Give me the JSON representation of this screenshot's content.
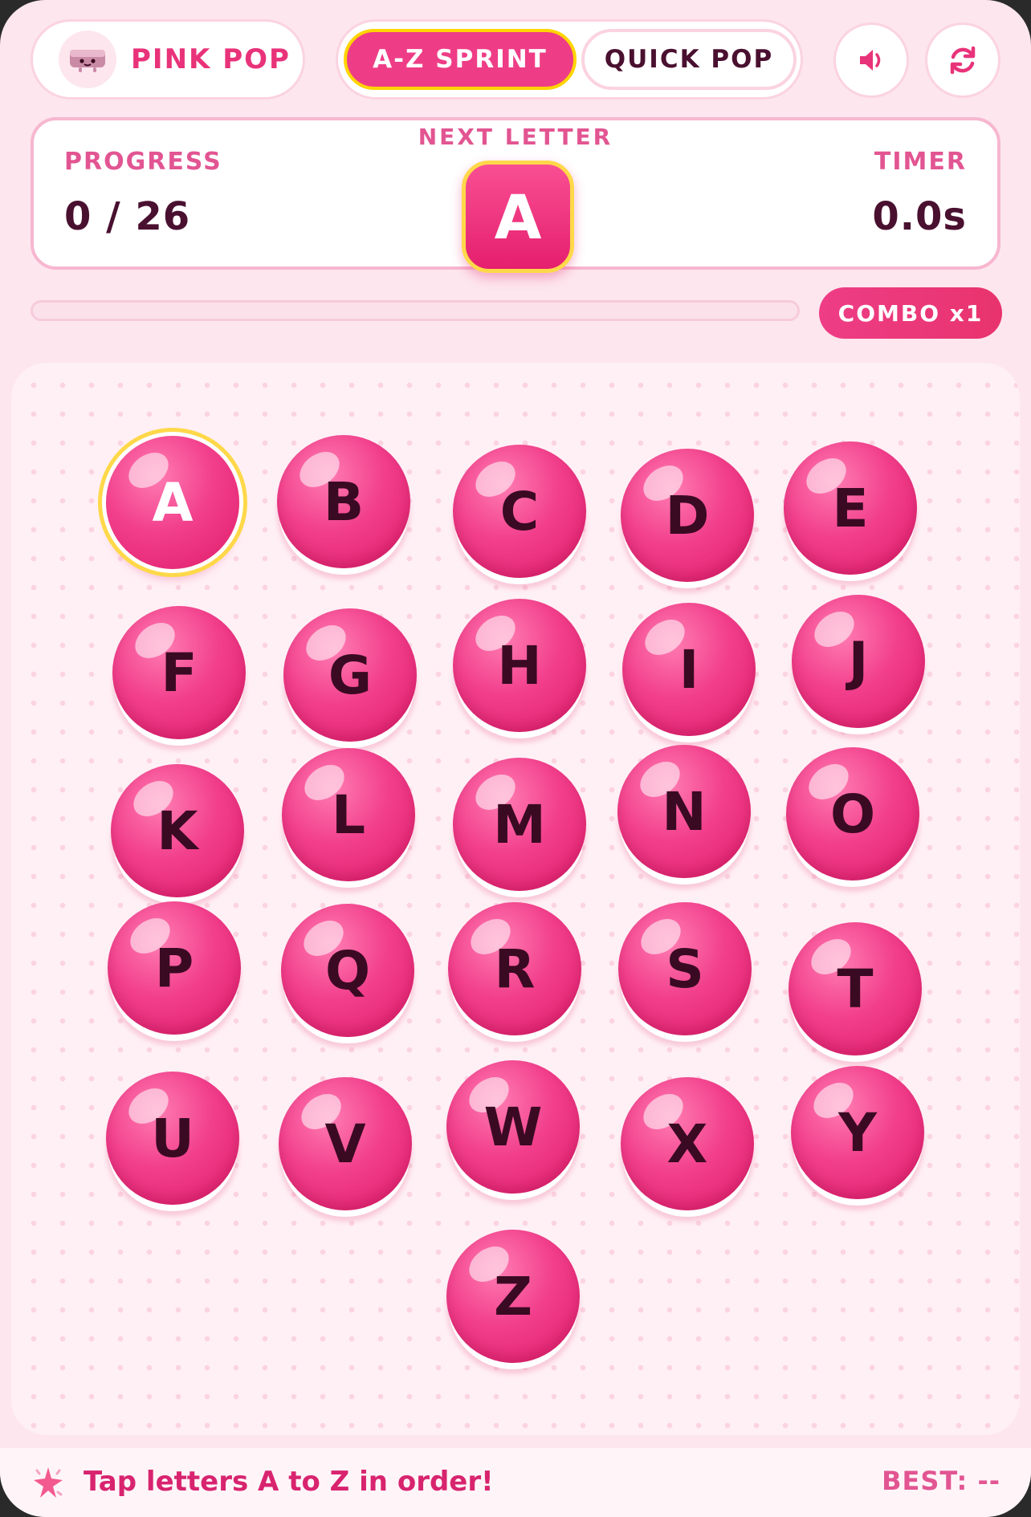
{
  "brand": {
    "name": "PINK POP",
    "logo_icon": "eraser-mascot-icon"
  },
  "modes": [
    {
      "label": "A-Z SPRINT",
      "selected": true
    },
    {
      "label": "QUICK POP",
      "selected": false
    }
  ],
  "controls": {
    "sound_icon": "speaker-icon",
    "restart_icon": "restart-icon"
  },
  "status": {
    "progress_label": "PROGRESS",
    "progress_value": "0 / 26",
    "next_label": "NEXT LETTER",
    "next_letter": "A",
    "timer_label": "TIMER",
    "timer_value": "0.0s"
  },
  "progress_fraction": 0,
  "combo": "COMBO x1",
  "bubbles": [
    "A",
    "B",
    "C",
    "D",
    "E",
    "F",
    "G",
    "H",
    "I",
    "J",
    "K",
    "L",
    "M",
    "N",
    "O",
    "P",
    "Q",
    "R",
    "S",
    "T",
    "U",
    "V",
    "W",
    "X",
    "Y",
    "Z"
  ],
  "active_letter": "A",
  "footer": {
    "hint": "Tap letters A to Z in order!",
    "best": "BEST: --",
    "hint_icon": "sparkle-icon"
  },
  "colors": {
    "accent": "#ee3d86",
    "highlight": "#ffd84a",
    "text_dark": "#4a1030"
  }
}
